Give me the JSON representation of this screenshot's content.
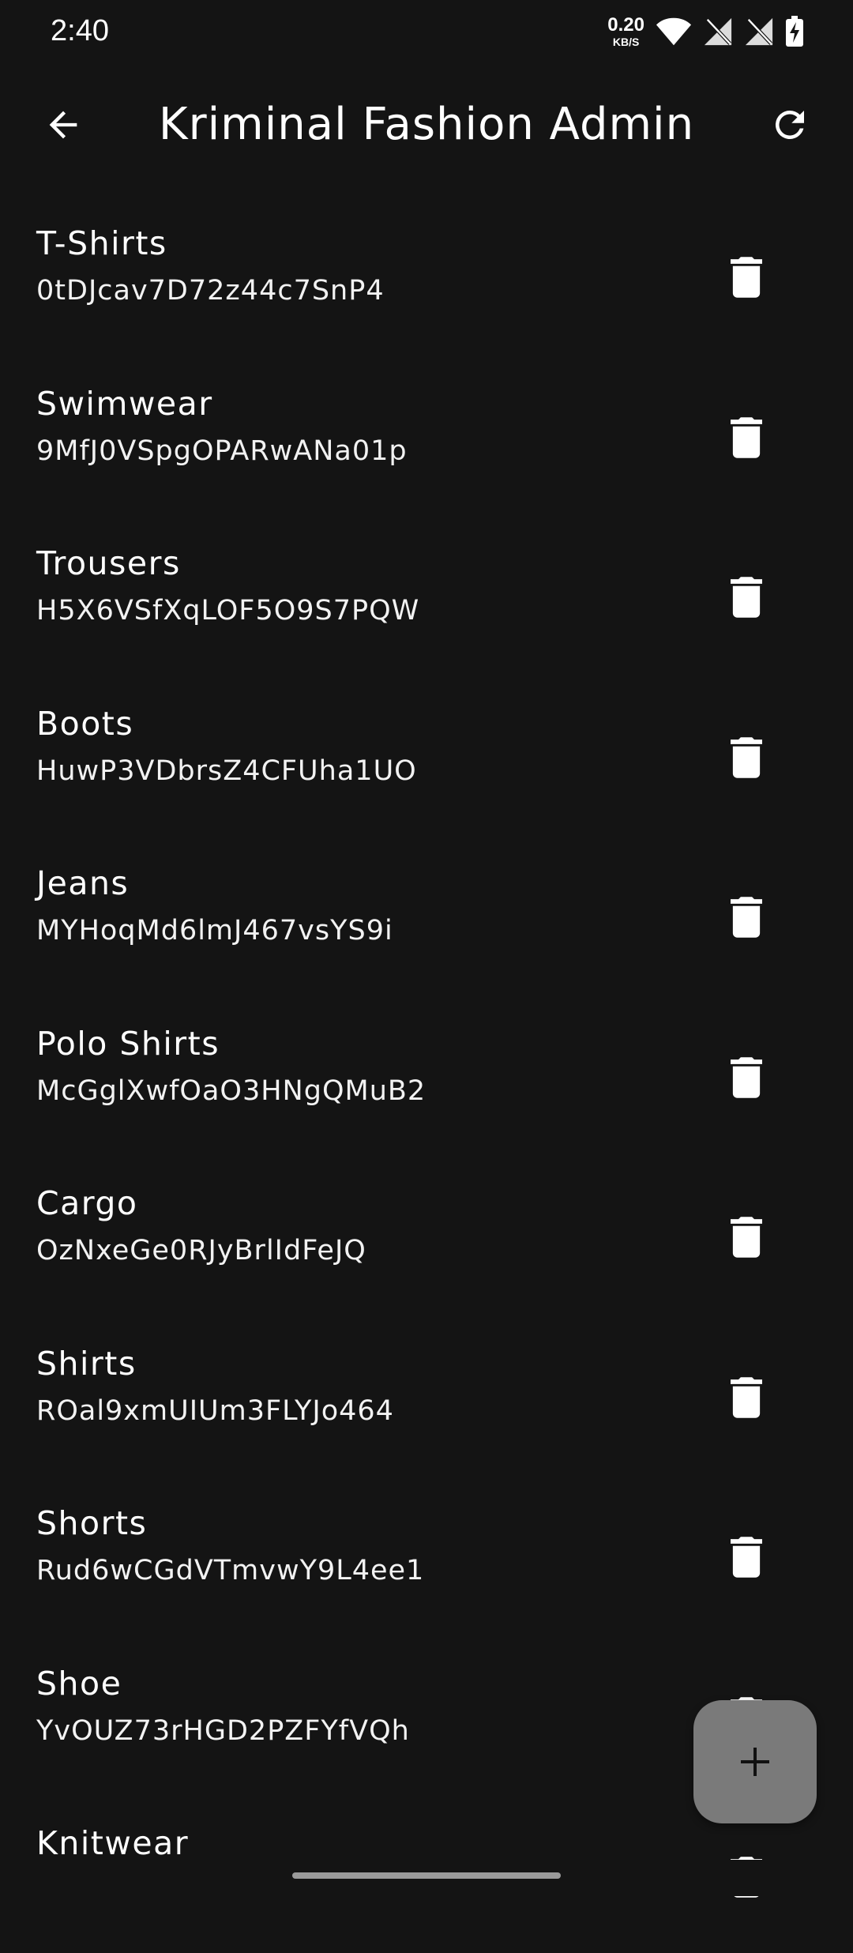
{
  "status_bar": {
    "time": "2:40",
    "net_speed_value": "0.20",
    "net_speed_unit": "KB/S"
  },
  "app_bar": {
    "title": "Kriminal Fashion Admin",
    "back_icon": "arrow-back-icon",
    "refresh_icon": "refresh-icon"
  },
  "categories": [
    {
      "name": "T-Shirts",
      "id": "0tDJcav7D72z44c7SnP4"
    },
    {
      "name": "Swimwear",
      "id": "9MfJ0VSpgOPARwANa01p"
    },
    {
      "name": "Trousers",
      "id": "H5X6VSfXqLOF5O9S7PQW"
    },
    {
      "name": "Boots",
      "id": "HuwP3VDbrsZ4CFUha1UO"
    },
    {
      "name": "Jeans",
      "id": "MYHoqMd6lmJ467vsYS9i"
    },
    {
      "name": "Polo Shirts",
      "id": "McGglXwfOaO3HNgQMuB2"
    },
    {
      "name": "Cargo",
      "id": "OzNxeGe0RJyBrlIdFeJQ"
    },
    {
      "name": "Shirts",
      "id": "ROal9xmUIUm3FLYJo464"
    },
    {
      "name": "Shorts",
      "id": "Rud6wCGdVTmvwY9L4ee1"
    },
    {
      "name": "Shoe",
      "id": "YvOUZ73rHGD2PZFYfVQh"
    },
    {
      "name": "Knitwear",
      "id": ""
    }
  ],
  "colors": {
    "background": "#141414",
    "text": "#ffffff",
    "fab": "#7a7a7a"
  }
}
